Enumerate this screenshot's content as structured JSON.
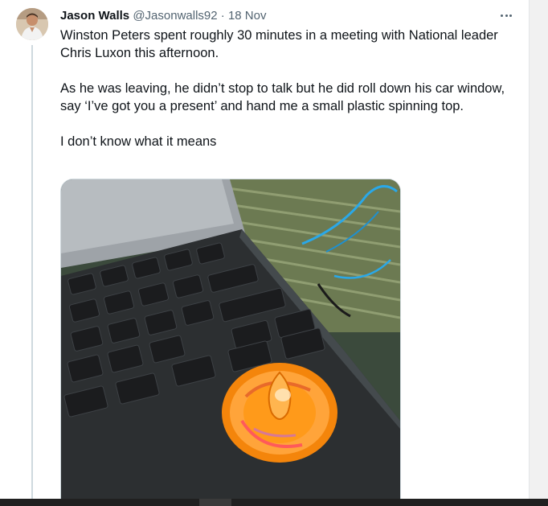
{
  "tweet": {
    "author_name": "Jason Walls",
    "handle": "@Jasonwalls92",
    "separator": "·",
    "date": "18 Nov",
    "paragraphs": [
      "Winston Peters spent roughly 30 minutes in a meeting with National leader Chris Luxon this afternoon.",
      "As he was leaving, he didn’t stop to talk but he did roll down his car window, say ‘I’ve got you a present’ and hand me a small plastic spinning top.",
      "I don’t know what it means"
    ]
  },
  "icons": {
    "more": "more-horizontal-icon",
    "avatar": "user-avatar"
  },
  "colors": {
    "text_primary": "#0f1419",
    "text_secondary": "#536471",
    "thread_line": "#cfd9de",
    "spinning_top": "#ff9a1a"
  }
}
